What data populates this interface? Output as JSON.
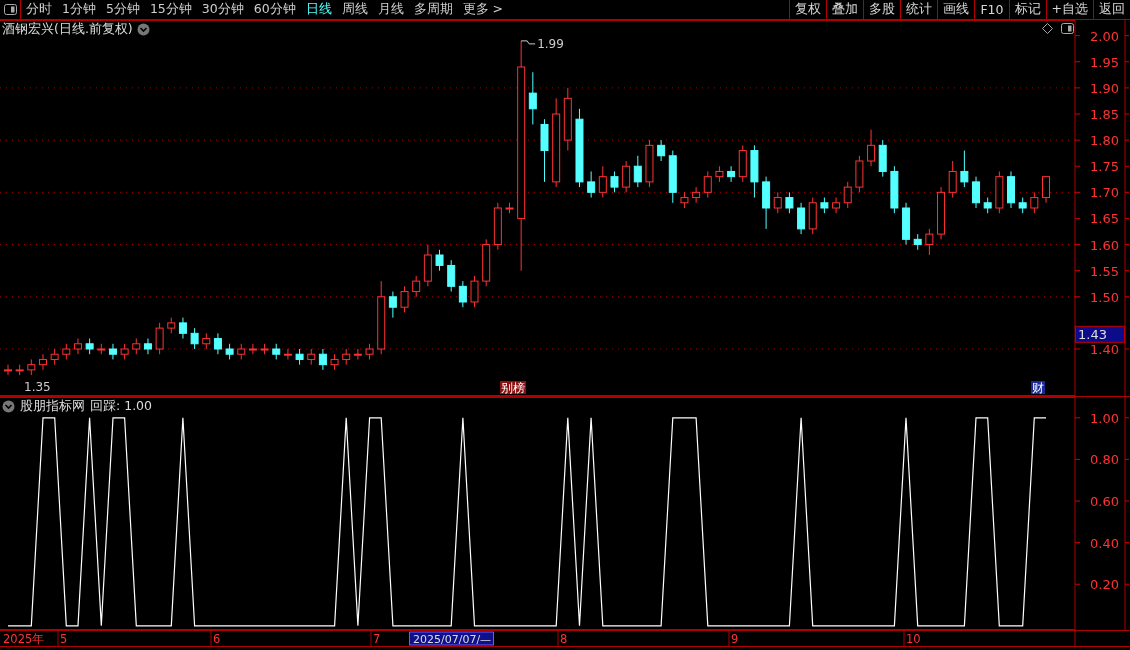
{
  "toolbar": {
    "periods": [
      {
        "label": "分时",
        "selected": false
      },
      {
        "label": "1分钟",
        "selected": false
      },
      {
        "label": "5分钟",
        "selected": false
      },
      {
        "label": "15分钟",
        "selected": false
      },
      {
        "label": "30分钟",
        "selected": false
      },
      {
        "label": "60分钟",
        "selected": false
      },
      {
        "label": "日线",
        "selected": true
      },
      {
        "label": "周线",
        "selected": false
      },
      {
        "label": "月线",
        "selected": false
      },
      {
        "label": "多周期",
        "selected": false
      },
      {
        "label": "更多 >",
        "selected": false
      }
    ],
    "actions": [
      "复权",
      "叠加",
      "多股",
      "统计",
      "画线",
      "F10",
      "标记",
      "+自选",
      "返回"
    ]
  },
  "price_pane": {
    "title": "酒钢宏兴(日线.前复权)",
    "high_label": "1.99",
    "low_label": "1.35",
    "current_price": "1.43",
    "event_tags": [
      {
        "label": "别榜",
        "color": "#8b1010"
      },
      {
        "label": "财",
        "color": "#1a2a9a"
      }
    ],
    "chart_data": {
      "type": "candlestick",
      "ylim": [
        1.31,
        2.03
      ],
      "yticks": [
        {
          "value": 2.0,
          "label": "2.00"
        },
        {
          "value": 1.95,
          "label": "1.95"
        },
        {
          "value": 1.9,
          "label": "1.90"
        },
        {
          "value": 1.85,
          "label": "1.85"
        },
        {
          "value": 1.8,
          "label": "1.80"
        },
        {
          "value": 1.75,
          "label": "1.75"
        },
        {
          "value": 1.7,
          "label": "1.70"
        },
        {
          "value": 1.65,
          "label": "1.65"
        },
        {
          "value": 1.6,
          "label": "1.60"
        },
        {
          "value": 1.55,
          "label": "1.55"
        },
        {
          "value": 1.5,
          "label": "1.50"
        },
        {
          "value": 1.4,
          "label": "1.40"
        }
      ],
      "ohlc": [
        [
          1.36,
          1.37,
          1.35,
          1.36
        ],
        [
          1.36,
          1.37,
          1.35,
          1.36
        ],
        [
          1.36,
          1.38,
          1.35,
          1.37
        ],
        [
          1.37,
          1.39,
          1.36,
          1.38
        ],
        [
          1.38,
          1.4,
          1.37,
          1.39
        ],
        [
          1.39,
          1.41,
          1.38,
          1.4
        ],
        [
          1.4,
          1.42,
          1.39,
          1.41
        ],
        [
          1.41,
          1.42,
          1.39,
          1.4
        ],
        [
          1.4,
          1.41,
          1.39,
          1.4
        ],
        [
          1.4,
          1.41,
          1.38,
          1.39
        ],
        [
          1.39,
          1.41,
          1.38,
          1.4
        ],
        [
          1.4,
          1.42,
          1.39,
          1.41
        ],
        [
          1.41,
          1.42,
          1.39,
          1.4
        ],
        [
          1.4,
          1.45,
          1.39,
          1.44
        ],
        [
          1.44,
          1.46,
          1.43,
          1.45
        ],
        [
          1.45,
          1.46,
          1.42,
          1.43
        ],
        [
          1.43,
          1.44,
          1.4,
          1.41
        ],
        [
          1.41,
          1.43,
          1.4,
          1.42
        ],
        [
          1.42,
          1.43,
          1.39,
          1.4
        ],
        [
          1.4,
          1.41,
          1.38,
          1.39
        ],
        [
          1.39,
          1.41,
          1.38,
          1.4
        ],
        [
          1.4,
          1.41,
          1.39,
          1.4
        ],
        [
          1.4,
          1.41,
          1.39,
          1.4
        ],
        [
          1.4,
          1.41,
          1.38,
          1.39
        ],
        [
          1.39,
          1.4,
          1.38,
          1.39
        ],
        [
          1.39,
          1.4,
          1.37,
          1.38
        ],
        [
          1.38,
          1.4,
          1.37,
          1.39
        ],
        [
          1.39,
          1.4,
          1.36,
          1.37
        ],
        [
          1.37,
          1.39,
          1.36,
          1.38
        ],
        [
          1.38,
          1.4,
          1.37,
          1.39
        ],
        [
          1.39,
          1.4,
          1.38,
          1.39
        ],
        [
          1.39,
          1.41,
          1.38,
          1.4
        ],
        [
          1.4,
          1.53,
          1.39,
          1.5
        ],
        [
          1.5,
          1.51,
          1.46,
          1.48
        ],
        [
          1.48,
          1.52,
          1.47,
          1.51
        ],
        [
          1.51,
          1.54,
          1.5,
          1.53
        ],
        [
          1.53,
          1.6,
          1.52,
          1.58
        ],
        [
          1.58,
          1.59,
          1.55,
          1.56
        ],
        [
          1.56,
          1.57,
          1.51,
          1.52
        ],
        [
          1.52,
          1.53,
          1.48,
          1.49
        ],
        [
          1.49,
          1.54,
          1.48,
          1.53
        ],
        [
          1.53,
          1.61,
          1.52,
          1.6
        ],
        [
          1.6,
          1.68,
          1.59,
          1.67
        ],
        [
          1.67,
          1.68,
          1.66,
          1.67
        ],
        [
          1.65,
          1.99,
          1.55,
          1.94
        ],
        [
          1.89,
          1.93,
          1.83,
          1.86
        ],
        [
          1.83,
          1.84,
          1.72,
          1.78
        ],
        [
          1.72,
          1.88,
          1.71,
          1.85
        ],
        [
          1.8,
          1.9,
          1.78,
          1.88
        ],
        [
          1.84,
          1.86,
          1.71,
          1.72
        ],
        [
          1.72,
          1.74,
          1.69,
          1.7
        ],
        [
          1.7,
          1.75,
          1.69,
          1.73
        ],
        [
          1.73,
          1.74,
          1.7,
          1.71
        ],
        [
          1.71,
          1.76,
          1.7,
          1.75
        ],
        [
          1.75,
          1.77,
          1.71,
          1.72
        ],
        [
          1.72,
          1.8,
          1.71,
          1.79
        ],
        [
          1.79,
          1.8,
          1.76,
          1.77
        ],
        [
          1.77,
          1.78,
          1.68,
          1.7
        ],
        [
          1.68,
          1.7,
          1.67,
          1.69
        ],
        [
          1.69,
          1.71,
          1.68,
          1.7
        ],
        [
          1.7,
          1.74,
          1.69,
          1.73
        ],
        [
          1.73,
          1.75,
          1.72,
          1.74
        ],
        [
          1.74,
          1.75,
          1.72,
          1.73
        ],
        [
          1.73,
          1.79,
          1.72,
          1.78
        ],
        [
          1.78,
          1.79,
          1.69,
          1.72
        ],
        [
          1.72,
          1.73,
          1.63,
          1.67
        ],
        [
          1.67,
          1.7,
          1.66,
          1.69
        ],
        [
          1.69,
          1.7,
          1.66,
          1.67
        ],
        [
          1.67,
          1.68,
          1.62,
          1.63
        ],
        [
          1.63,
          1.69,
          1.62,
          1.68
        ],
        [
          1.68,
          1.69,
          1.66,
          1.67
        ],
        [
          1.67,
          1.69,
          1.66,
          1.68
        ],
        [
          1.68,
          1.72,
          1.67,
          1.71
        ],
        [
          1.71,
          1.77,
          1.7,
          1.76
        ],
        [
          1.76,
          1.82,
          1.75,
          1.79
        ],
        [
          1.79,
          1.8,
          1.73,
          1.74
        ],
        [
          1.74,
          1.75,
          1.66,
          1.67
        ],
        [
          1.67,
          1.68,
          1.6,
          1.61
        ],
        [
          1.61,
          1.62,
          1.59,
          1.6
        ],
        [
          1.6,
          1.63,
          1.58,
          1.62
        ],
        [
          1.62,
          1.71,
          1.61,
          1.7
        ],
        [
          1.7,
          1.76,
          1.69,
          1.74
        ],
        [
          1.74,
          1.78,
          1.71,
          1.72
        ],
        [
          1.72,
          1.73,
          1.67,
          1.68
        ],
        [
          1.68,
          1.69,
          1.66,
          1.67
        ],
        [
          1.67,
          1.74,
          1.66,
          1.73
        ],
        [
          1.73,
          1.74,
          1.67,
          1.68
        ],
        [
          1.68,
          1.69,
          1.66,
          1.67
        ],
        [
          1.67,
          1.7,
          1.66,
          1.69
        ],
        [
          1.69,
          1.73,
          1.68,
          1.73
        ]
      ]
    }
  },
  "indicator_pane": {
    "title": "股朋指标网",
    "reading": "回踩: 1.00",
    "chart_data": {
      "type": "line",
      "ylim": [
        -0.02,
        1.1
      ],
      "yticks": [
        {
          "value": 1.0,
          "label": "1.00"
        },
        {
          "value": 0.8,
          "label": "0.80"
        },
        {
          "value": 0.6,
          "label": "0.60"
        },
        {
          "value": 0.4,
          "label": "0.40"
        },
        {
          "value": 0.2,
          "label": "0.20"
        }
      ],
      "series": [
        {
          "color": "#ffffff",
          "values": [
            0,
            0,
            0,
            1,
            1,
            0,
            0,
            1,
            0,
            1,
            1,
            0,
            0,
            0,
            0,
            1,
            0,
            0,
            0,
            0,
            0,
            0,
            0,
            0,
            0,
            0,
            0,
            0,
            0,
            1,
            0,
            1,
            1,
            0,
            0,
            0,
            0,
            0,
            0,
            1,
            0,
            0,
            0,
            0,
            0,
            0,
            0,
            0,
            1,
            0,
            1,
            0,
            0,
            0,
            0,
            0,
            0,
            1,
            1,
            1,
            0,
            0,
            0,
            0,
            0,
            0,
            0,
            0,
            1,
            0,
            0,
            0,
            0,
            0,
            0,
            0,
            0,
            1,
            0,
            0,
            0,
            0,
            0,
            1,
            1,
            0,
            0,
            0,
            1,
            1
          ]
        }
      ]
    }
  },
  "time_axis": {
    "labels": [
      "2025年",
      "5",
      "6",
      "7",
      "8",
      "9",
      "10"
    ],
    "cursor_date": "2025/07/07/—"
  }
}
